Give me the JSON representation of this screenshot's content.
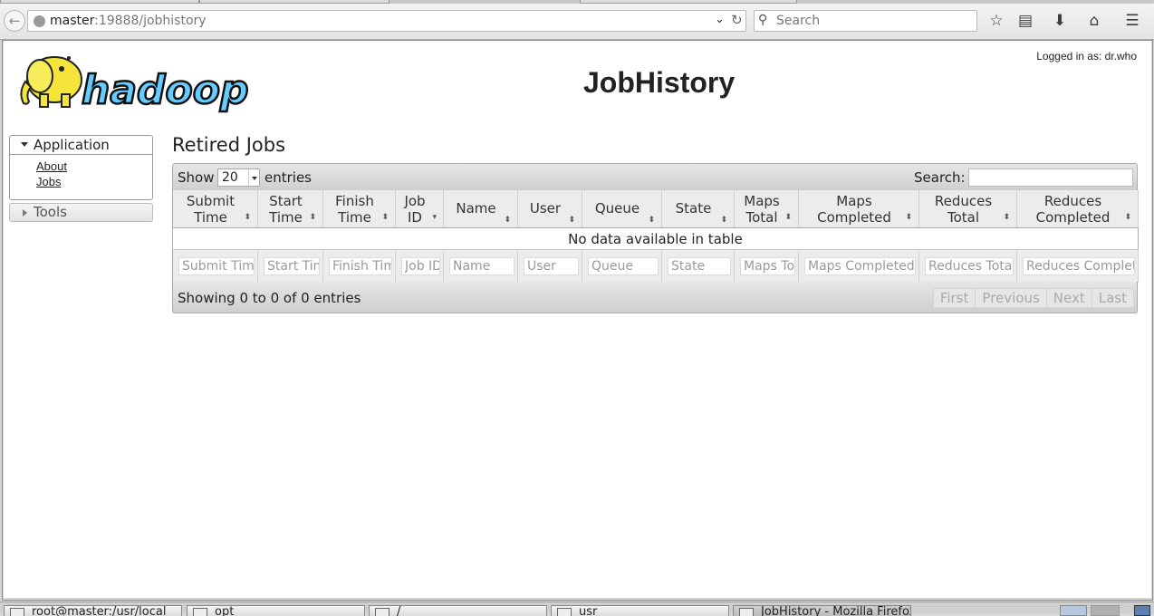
{
  "browser": {
    "url_host": "master",
    "url_rest": ":19888/jobhistory",
    "search_placeholder": "Search"
  },
  "header": {
    "logo_text": "hadoop",
    "title": "JobHistory",
    "login": "Logged in as: dr.who"
  },
  "sidebar": {
    "application_label": "Application",
    "links": [
      "About",
      "Jobs"
    ],
    "tools_label": "Tools"
  },
  "main": {
    "title": "Retired Jobs",
    "show_label": "Show",
    "page_size": "20",
    "entries_label": "entries",
    "search_label": "Search:",
    "columns": [
      {
        "line1": "Submit",
        "line2": "Time",
        "filter": "Submit Time"
      },
      {
        "line1": "Start",
        "line2": "Time",
        "filter": "Start Time"
      },
      {
        "line1": "Finish",
        "line2": "Time",
        "filter": "Finish Time"
      },
      {
        "line1": "Job",
        "line2": "ID",
        "filter": "Job ID"
      },
      {
        "line1": "Name",
        "line2": "",
        "filter": "Name"
      },
      {
        "line1": "User",
        "line2": "",
        "filter": "User"
      },
      {
        "line1": "Queue",
        "line2": "",
        "filter": "Queue"
      },
      {
        "line1": "State",
        "line2": "",
        "filter": "State"
      },
      {
        "line1": "Maps",
        "line2": "Total",
        "filter": "Maps Total"
      },
      {
        "line1": "Maps",
        "line2": "Completed",
        "filter": "Maps Completed"
      },
      {
        "line1": "Reduces",
        "line2": "Total",
        "filter": "Reduces Total"
      },
      {
        "line1": "Reduces",
        "line2": "Completed",
        "filter": "Reduces Completed"
      }
    ],
    "empty_message": "No data available in table",
    "info": "Showing 0 to 0 of 0 entries",
    "pager": [
      "First",
      "Previous",
      "Next",
      "Last"
    ]
  },
  "taskbar": {
    "items": [
      "root@master:/usr/local",
      "opt",
      "/",
      "usr",
      "JobHistory - Mozilla Firefox"
    ]
  }
}
